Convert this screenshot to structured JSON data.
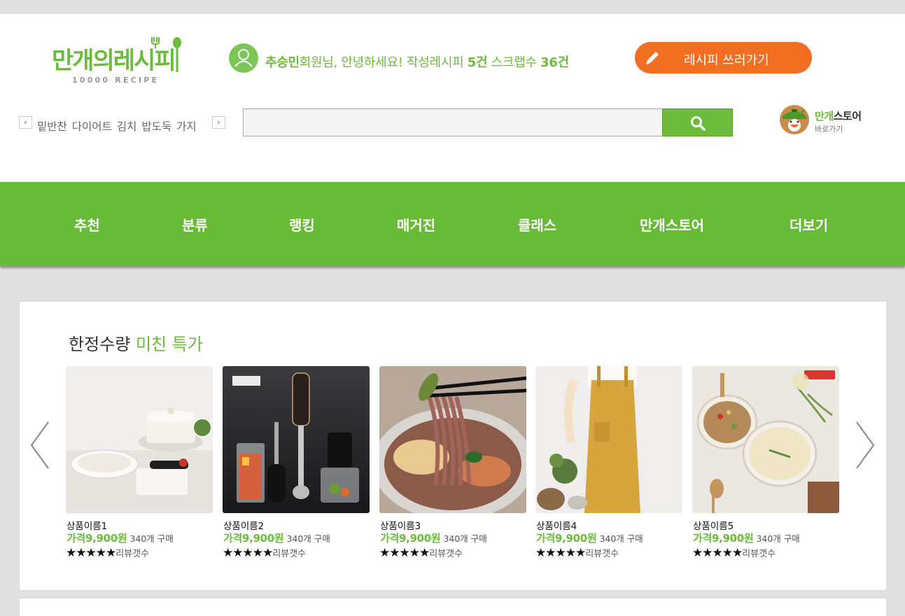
{
  "header": {
    "logo": {
      "text": "만개의레시피",
      "subtitle": "10000 RECIPE"
    },
    "user": {
      "name": "추승민",
      "greeting": "회원님, 안녕하세요! 작성레시피 ",
      "recipe_count": "5건",
      "scrap_label": " 스크랩수 ",
      "scrap_count": "36건"
    },
    "write_button": "레시피 쓰러가기",
    "keywords": [
      "밑반찬",
      "다이어트",
      "김치",
      "밥도둑",
      "가지"
    ],
    "search": {
      "placeholder": "",
      "value": ""
    },
    "store": {
      "title_green": "만개",
      "title_dark": "스토어",
      "subtitle": "바로가기"
    }
  },
  "nav": {
    "items": [
      "추천",
      "분류",
      "랭킹",
      "매거진",
      "클래스",
      "만개스토어",
      "더보기"
    ]
  },
  "deals": {
    "title_plain": "한정수량 ",
    "title_highlight": "미친 특가",
    "products": [
      {
        "name": "상품이름1",
        "price": "가격9,900원",
        "buy": "340개 구매",
        "stars": "★★★★★",
        "review": "리뷰갯수"
      },
      {
        "name": "상품이름2",
        "price": "가격9,900원",
        "buy": "340개 구매",
        "stars": "★★★★★",
        "review": "리뷰갯수"
      },
      {
        "name": "상품이름3",
        "price": "가격9,900원",
        "buy": "340개 구매",
        "stars": "★★★★★",
        "review": "리뷰갯수"
      },
      {
        "name": "상품이름4",
        "price": "가격9,900원",
        "buy": "340개 구매",
        "stars": "★★★★★",
        "review": "리뷰갯수"
      },
      {
        "name": "상품이름5",
        "price": "가격9,900원",
        "buy": "340개 구매",
        "stars": "★★★★★",
        "review": "리뷰갯수"
      }
    ]
  },
  "colors": {
    "brand_green": "#6cbb3c",
    "nav_green": "#67bb36",
    "accent_orange": "#f26f22"
  }
}
